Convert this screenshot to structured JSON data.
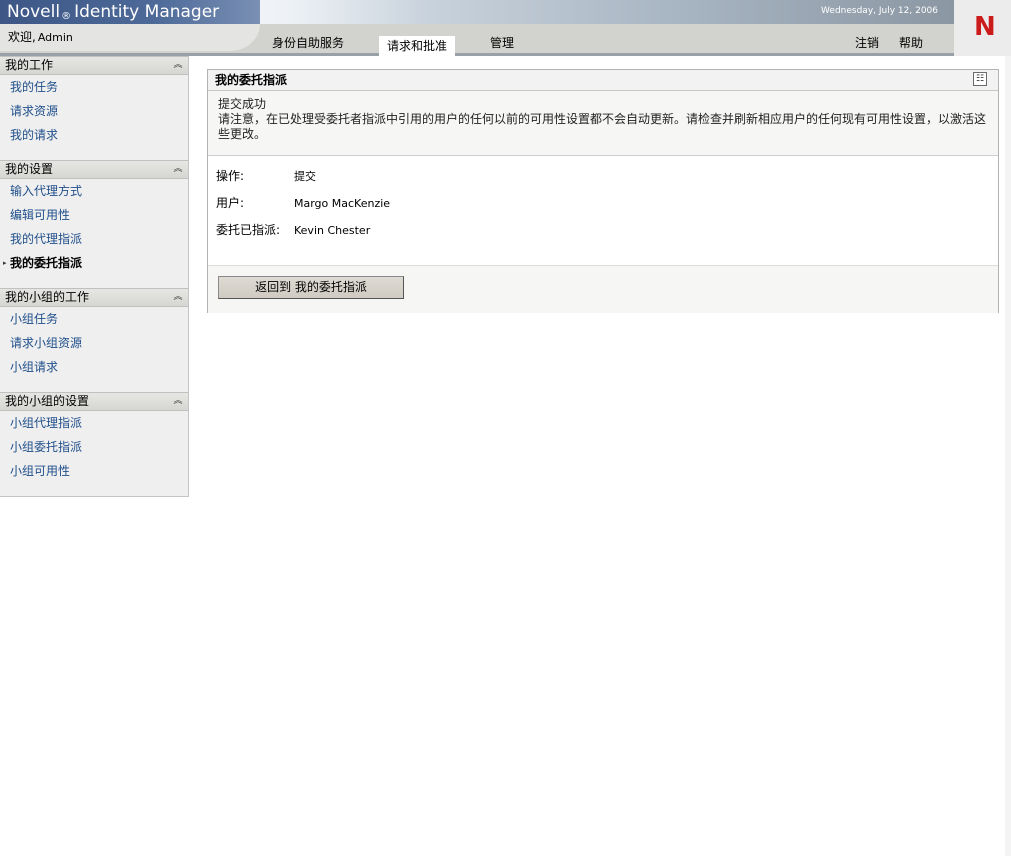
{
  "header": {
    "brand": "Novell",
    "brand_mark": "®",
    "product": "Identity Manager",
    "date": "Wednesday, July 12, 2006",
    "welcome_label": "欢迎,",
    "user_name": "Admin",
    "tabs": [
      {
        "label": "身份自助服务",
        "active": false
      },
      {
        "label": "请求和批准",
        "active": true
      },
      {
        "label": "管理",
        "active": false
      }
    ],
    "logout_label": "注销",
    "help_label": "帮助",
    "logo_letter": "N",
    "logo_color": "#cc1b1b"
  },
  "sidebar": {
    "sections": [
      {
        "title": "我的工作",
        "items": [
          "我的任务",
          "请求资源",
          "我的请求"
        ]
      },
      {
        "title": "我的设置",
        "items": [
          "输入代理方式",
          "编辑可用性",
          "我的代理指派",
          "我的委托指派"
        ],
        "current_index": 3
      },
      {
        "title": "我的小组的工作",
        "items": [
          "小组任务",
          "请求小组资源",
          "小组请求"
        ]
      },
      {
        "title": "我的小组的设置",
        "items": [
          "小组代理指派",
          "小组委托指派",
          "小组可用性"
        ]
      }
    ],
    "collapse_icon": "collapse-up-icon"
  },
  "panel": {
    "title": "我的委托指派",
    "message_title": "提交成功",
    "message_body": "请注意，在已处理受委托者指派中引用的用户的任何以前的可用性设置都不会自动更新。请检查并刷新相应用户的任何现有可用性设置，以激活这些更改。",
    "fields": [
      {
        "label": "操作:",
        "value": "提交"
      },
      {
        "label": "用户:",
        "value": "Margo MacKenzie"
      },
      {
        "label": "委托已指派:",
        "value": "Kevin Chester"
      }
    ],
    "back_button_label": "返回到  我的委托指派"
  }
}
